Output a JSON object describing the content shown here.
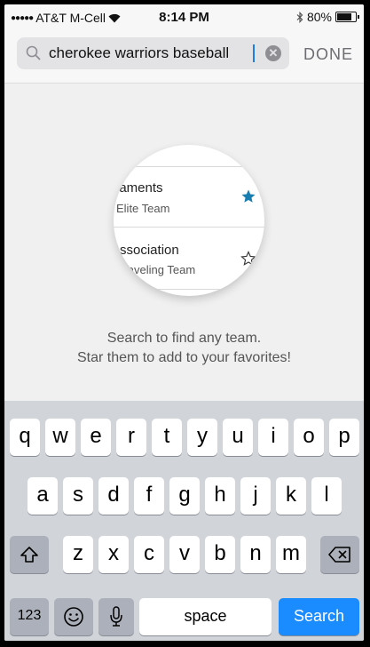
{
  "status_bar": {
    "signal_dots": "●●●●●",
    "carrier": "AT&T M-Cell",
    "time": "8:14 PM",
    "battery_percent": "80%",
    "battery_level": 0.8
  },
  "search": {
    "query": "cherokee warriors baseball",
    "done_label": "DONE"
  },
  "illustration": {
    "row1_title": "iaments",
    "row1_subtitle": "Elite Team",
    "row2_title": "Association",
    "row2_subtitle": "Traveling Team"
  },
  "empty_state": {
    "line1": "Search to find any team.",
    "line2": "Star them to add to your favorites!"
  },
  "keyboard": {
    "row1": [
      "q",
      "w",
      "e",
      "r",
      "t",
      "y",
      "u",
      "i",
      "o",
      "p"
    ],
    "row2": [
      "a",
      "s",
      "d",
      "f",
      "g",
      "h",
      "j",
      "k",
      "l"
    ],
    "row3": [
      "z",
      "x",
      "c",
      "v",
      "b",
      "n",
      "m"
    ],
    "numbers_label": "123",
    "space_label": "space",
    "search_label": "Search"
  },
  "colors": {
    "accent_star": "#1a7db0",
    "search_key": "#1a8cff"
  }
}
